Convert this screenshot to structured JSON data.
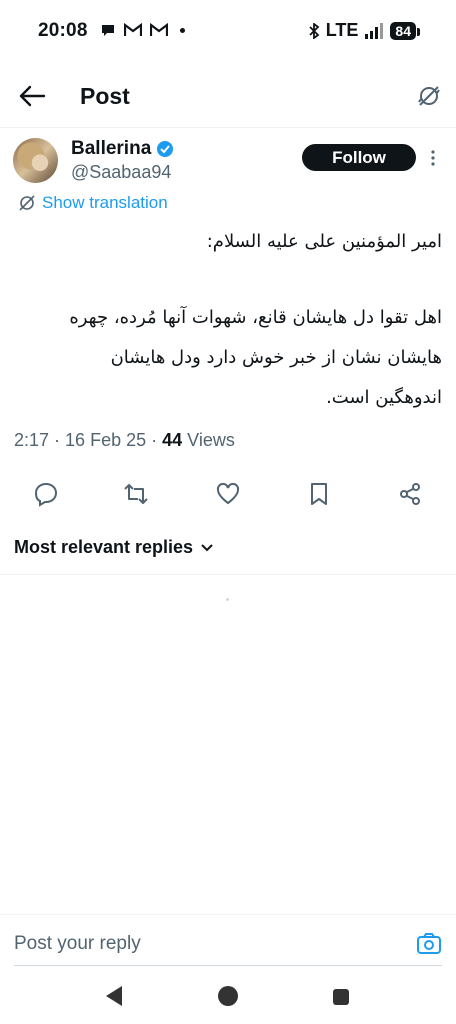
{
  "status_bar": {
    "time": "20:08",
    "network": "LTE",
    "battery": "84"
  },
  "header": {
    "title": "Post"
  },
  "author": {
    "name": "Ballerina",
    "handle": "@Saabaa94",
    "follow_label": "Follow"
  },
  "translate_label": "Show translation",
  "post": {
    "lines": [
      "امیر المؤمنین علی علیه السلام:",
      "اهل تقوا دل هایشان قانع، شهوات آنها مُرده، چهره",
      "هایشان نشان از خبر خوش دارد ودل هایشان",
      "اندوهگین است."
    ],
    "time": "2:17",
    "date": "16 Feb 25",
    "views_count": "44",
    "views_label": "Views"
  },
  "replies_header": "Most relevant replies",
  "reply_placeholder": "Post your reply",
  "icons": {
    "reply": "reply-icon",
    "repost": "repost-icon",
    "like": "heart-icon",
    "bookmark": "bookmark-icon",
    "share": "share-icon",
    "verified": "verified-badge-icon"
  },
  "colors": {
    "accent": "#1d9bf0",
    "text": "#0f1419",
    "secondary": "#536471"
  }
}
